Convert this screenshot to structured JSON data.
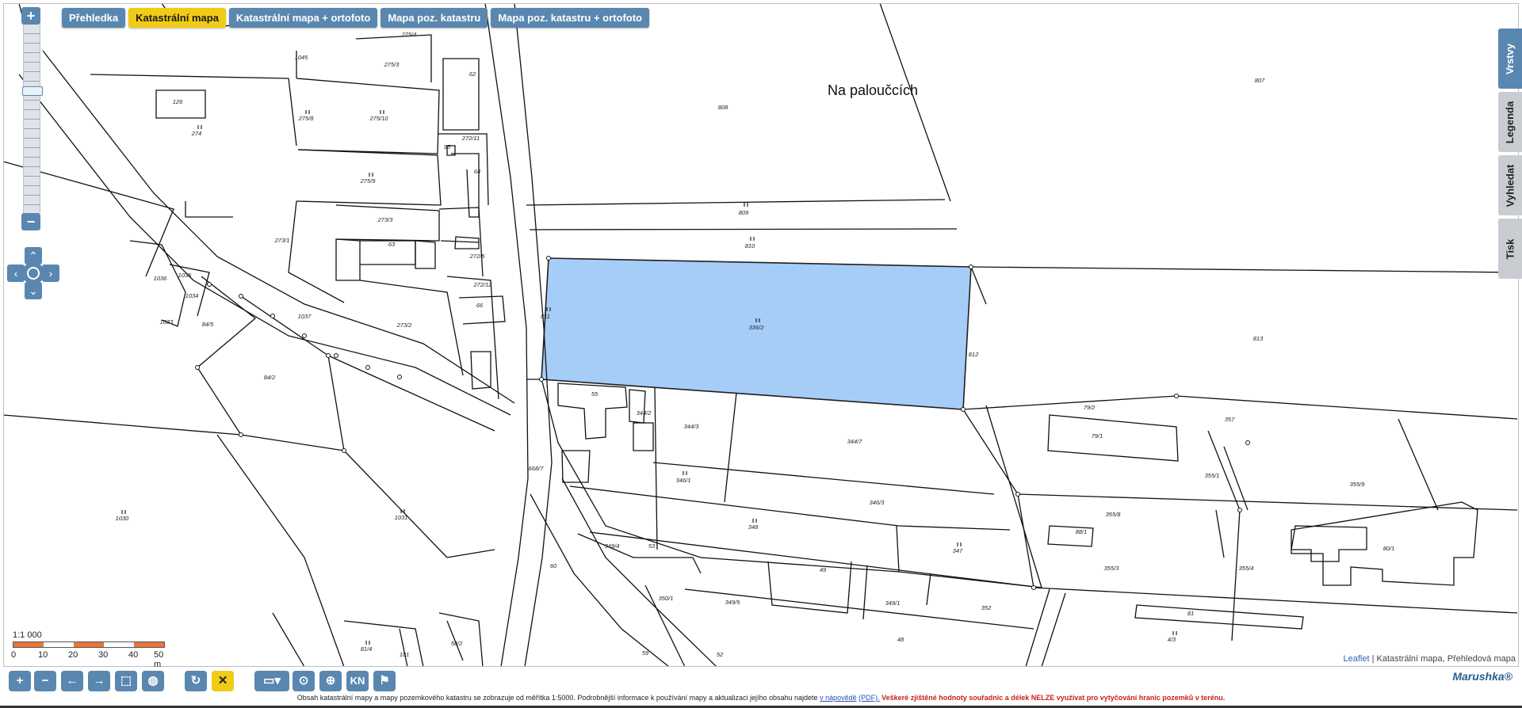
{
  "tabs": [
    "Přehledka",
    "Katastrální mapa",
    "Katastrální mapa + ortofoto",
    "Mapa poz. katastru",
    "Mapa poz. katastru + ortofoto"
  ],
  "active_tab": "Katastrální mapa",
  "side_tabs": [
    "Vrstvy",
    "Legenda",
    "Vyhledat",
    "Tisk"
  ],
  "zoom": {
    "in": "+",
    "out": "−"
  },
  "pan": {
    "up": "⌃",
    "down": "⌄",
    "left": "‹",
    "right": "›"
  },
  "place_name": "Na paloučcích",
  "parcels": [
    {
      "label": "807"
    },
    {
      "label": "808"
    },
    {
      "label": "809"
    },
    {
      "label": "810"
    },
    {
      "label": "336/2"
    },
    {
      "label": "811"
    },
    {
      "label": "812"
    },
    {
      "label": "813"
    },
    {
      "label": "357"
    },
    {
      "label": "79/2"
    },
    {
      "label": "79/1"
    },
    {
      "label": "355/1"
    },
    {
      "label": "355/9"
    },
    {
      "label": "355/8"
    },
    {
      "label": "355/3"
    },
    {
      "label": "355/4"
    },
    {
      "label": "80/1"
    },
    {
      "label": "88/1"
    },
    {
      "label": "81"
    },
    {
      "label": "4/3"
    },
    {
      "label": "344/7"
    },
    {
      "label": "344/3"
    },
    {
      "label": "344/2"
    },
    {
      "label": "346/1"
    },
    {
      "label": "346/3"
    },
    {
      "label": "348"
    },
    {
      "label": "347"
    },
    {
      "label": "349/4"
    },
    {
      "label": "53"
    },
    {
      "label": "49"
    },
    {
      "label": "349/1"
    },
    {
      "label": "352"
    },
    {
      "label": "349/5"
    },
    {
      "label": "350/1"
    },
    {
      "label": "48"
    },
    {
      "label": "52"
    },
    {
      "label": "59"
    },
    {
      "label": "60"
    },
    {
      "label": "55"
    },
    {
      "label": "668/7"
    },
    {
      "label": "275/4"
    },
    {
      "label": "275/3"
    },
    {
      "label": "62"
    },
    {
      "label": "275/10"
    },
    {
      "label": "275/8"
    },
    {
      "label": "1045"
    },
    {
      "label": "126"
    },
    {
      "label": "274"
    },
    {
      "label": "272/11"
    },
    {
      "label": "64"
    },
    {
      "label": "275/9"
    },
    {
      "label": "273/3"
    },
    {
      "label": "63"
    },
    {
      "label": "273/1"
    },
    {
      "label": "272/5"
    },
    {
      "label": "272/12"
    },
    {
      "label": "66"
    },
    {
      "label": "273/2"
    },
    {
      "label": "1036"
    },
    {
      "label": "1035"
    },
    {
      "label": "1034"
    },
    {
      "label": "1033"
    },
    {
      "label": "84/5"
    },
    {
      "label": "1037"
    },
    {
      "label": "84/2"
    },
    {
      "label": "1030"
    },
    {
      "label": "1031"
    },
    {
      "label": "81/4"
    },
    {
      "label": "101"
    },
    {
      "label": "58/2"
    },
    {
      "label": "95"
    }
  ],
  "highlighted_parcel": "336/2",
  "scale": {
    "ratio": "1:1 000",
    "ticks": [
      "0",
      "10",
      "20",
      "30",
      "40",
      "50 m"
    ]
  },
  "attribution": {
    "leaflet": "Leaflet",
    "text": "| Katastrální mapa, Přehledová mapa"
  },
  "toolbar": {
    "buttons": [
      "zoom-in",
      "zoom-out",
      "back",
      "forward",
      "full-extent",
      "globe",
      "refresh",
      "clear",
      "measure",
      "location",
      "gps",
      "KN",
      "flag"
    ],
    "kn_label": "KN"
  },
  "brand": "Marushka®",
  "footnote": {
    "text": "Obsah katastrální mapy a mapy pozemkového katastru se zobrazuje od měřítka 1:5000. Podrobnější informace k používání mapy a aktualizaci jejího obsahu najdete",
    "link": "v nápovědě",
    "pdf": "(PDF).",
    "warning": "Veškeré zjištěné hodnoty souřadnic a délek NELZE využívat pro vytyčování hranic pozemků v terénu."
  },
  "colors": {
    "accent": "#5a87b0",
    "active_tab": "#f0cc16",
    "parcel_fill": "#a6cdf8",
    "scale_orange": "#e8753a",
    "warning": "#c82020"
  }
}
